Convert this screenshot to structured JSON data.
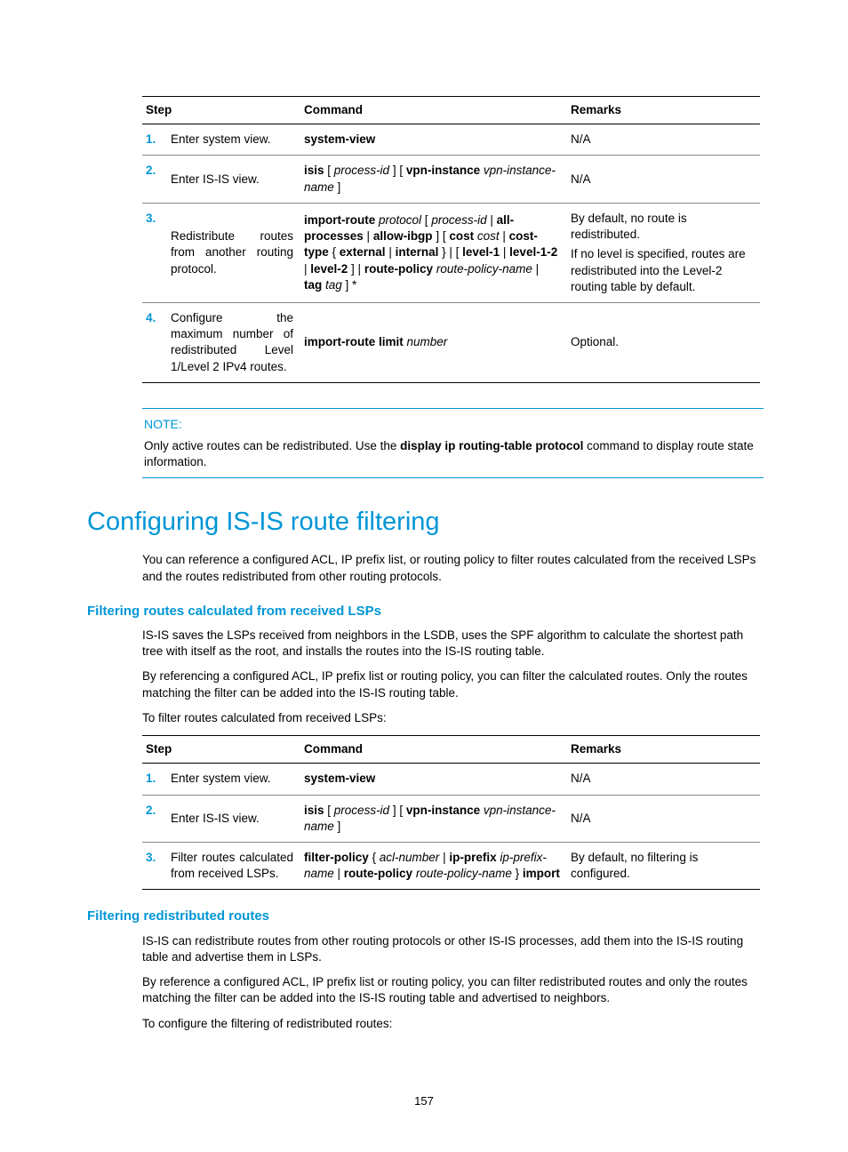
{
  "table1": {
    "headers": {
      "step": "Step",
      "command": "Command",
      "remarks": "Remarks"
    },
    "rows": [
      {
        "num": "1.",
        "desc": "Enter system view.",
        "command_html": "<b>system-view</b>",
        "remarks_html": "N/A"
      },
      {
        "num": "2.",
        "desc": "Enter IS-IS view.",
        "command_html": "<b>isis</b> [ <i>process-id</i> ] [ <b>vpn-instance</b> <i>vpn-instance-name</i> ]",
        "remarks_html": "N/A"
      },
      {
        "num": "3.",
        "desc": "Redistribute routes from another routing protocol.",
        "command_html": "<b>import-route</b> <i>protocol</i> [ <i>process-id</i> | <b>all-processes</b> | <b>allow-ibgp</b> ] [ <b>cost</b> <i>cost</i> | <b>cost-type</b> { <b>external</b> | <b>internal</b> } | [ <b>level-1</b> | <b>level-1-2</b> | <b>level-2</b> ] | <b>route-policy</b> <i>route-policy-name</i> | <b>tag</b> <i>tag</i> ] *",
        "remarks_html": "<p>By default, no route is redistributed.</p><p>If no level is specified, routes are redistributed into the Level-2 routing table by default.</p>"
      },
      {
        "num": "4.",
        "desc": "Configure the maximum number of redistributed Level 1/Level 2 IPv4 routes.",
        "command_html": "<b>import-route limit</b> <i>number</i>",
        "remarks_html": "Optional."
      }
    ]
  },
  "note": {
    "label": "NOTE:",
    "body_html": "Only active routes can be redistributed. Use the <b>display ip routing-table protocol</b> command to display route state information."
  },
  "h1": "Configuring IS-IS route filtering",
  "intro": "You can reference a configured ACL, IP prefix list, or routing policy to filter routes calculated from the received LSPs and the routes redistributed from other routing protocols.",
  "section1": {
    "title": "Filtering routes calculated from received LSPs",
    "p1": "IS-IS saves the LSPs received from neighbors in the LSDB, uses the SPF algorithm to calculate the shortest path tree with itself as the root, and installs the routes into the IS-IS routing table.",
    "p2": "By referencing a configured ACL, IP prefix list or routing policy, you can filter the calculated routes. Only the routes matching the filter can be added into the IS-IS routing table.",
    "p3": "To filter routes calculated from received LSPs:"
  },
  "table2": {
    "headers": {
      "step": "Step",
      "command": "Command",
      "remarks": "Remarks"
    },
    "rows": [
      {
        "num": "1.",
        "desc": "Enter system view.",
        "command_html": "<b>system-view</b>",
        "remarks_html": "N/A"
      },
      {
        "num": "2.",
        "desc": "Enter IS-IS view.",
        "command_html": "<b>isis</b> [ <i>process-id</i> ] [ <b>vpn-instance</b> <i>vpn-instance-name</i> ]",
        "remarks_html": "N/A"
      },
      {
        "num": "3.",
        "desc": "Filter routes calculated from received LSPs.",
        "command_html": "<b>filter-policy</b> { <i>acl-number</i> | <b>ip-prefix</b> <i>ip-prefix-name</i> | <b>route-policy</b> <i>route-policy-name</i> } <b>import</b>",
        "remarks_html": "By default, no filtering is configured."
      }
    ]
  },
  "section2": {
    "title": "Filtering redistributed routes",
    "p1": "IS-IS can redistribute routes from other routing protocols or other IS-IS processes, add them into the IS-IS routing table and advertise them in LSPs.",
    "p2": "By reference a configured ACL, IP prefix list or routing policy, you can filter redistributed routes and only the routes matching the filter can be added into the IS-IS routing table and advertised to neighbors.",
    "p3": "To configure the filtering of redistributed routes:"
  },
  "page_number": "157"
}
